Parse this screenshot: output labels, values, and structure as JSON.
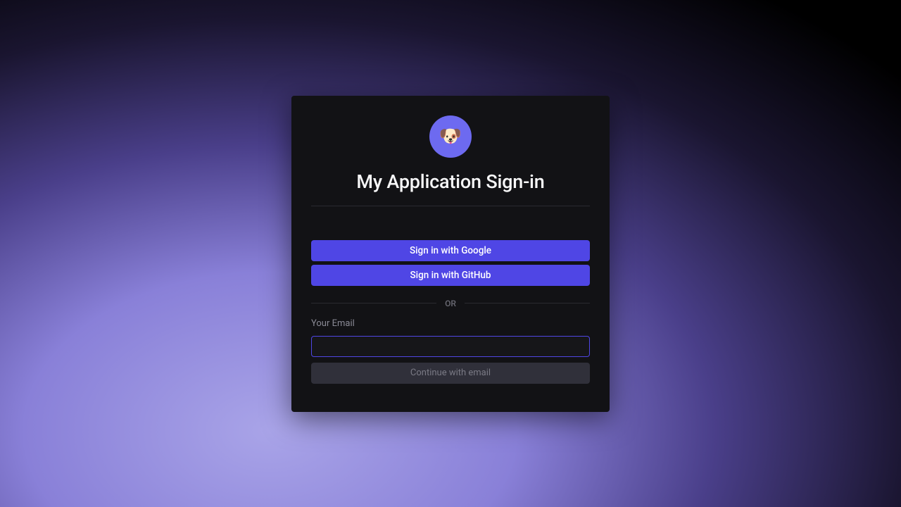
{
  "signin": {
    "logo_emoji": "🐶",
    "title": "My Application Sign-in",
    "providers": {
      "google": "Sign in with Google",
      "github": "Sign in with GitHub"
    },
    "divider": "OR",
    "email_label": "Your Email",
    "email_value": "",
    "email_placeholder": "",
    "continue_label": "Continue with email",
    "colors": {
      "primary": "#4f46e5",
      "card_bg": "#121215",
      "logo_bg": "#6d6af0"
    }
  }
}
